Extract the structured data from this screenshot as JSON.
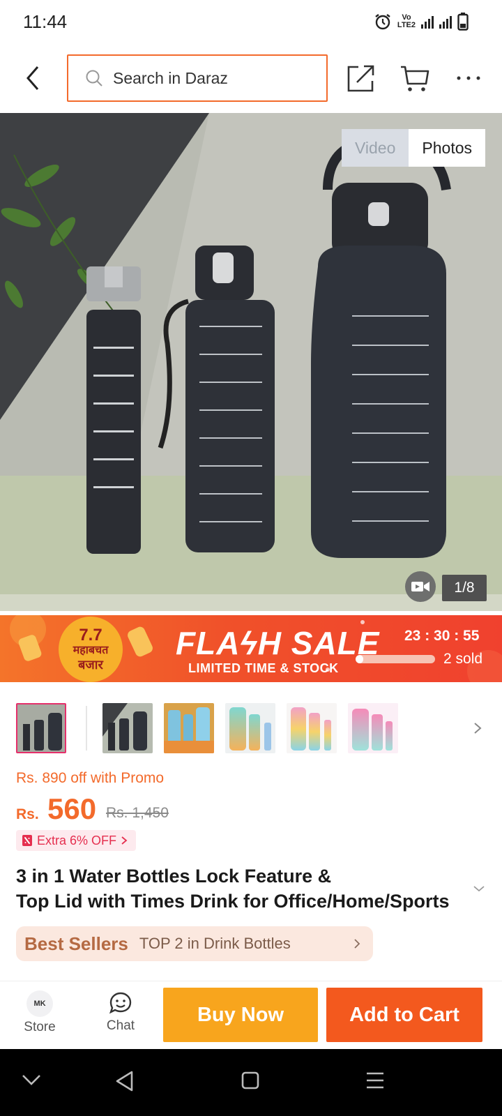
{
  "status_bar": {
    "time": "11:44",
    "network_label_1": "Vo",
    "network_label_2": "LTE2"
  },
  "header": {
    "search_placeholder": "Search in Daraz"
  },
  "media": {
    "toggle_video": "Video",
    "toggle_photos": "Photos",
    "counter": "1/8"
  },
  "flash_sale": {
    "title": "FLAϟH SALE",
    "subtitle": "LIMITED TIME & STOCK",
    "timer": "23 : 30 : 55",
    "sold": "2 sold",
    "sold_progress": 0.1,
    "badge_line1": "7.7",
    "badge_line2": "महाबचत",
    "badge_line3": "बजार"
  },
  "price": {
    "promo": "Rs. 890 off with Promo",
    "currency": "Rs.",
    "current": "560",
    "original": "Rs. 1,450",
    "extra_off": "Extra 6% OFF"
  },
  "product": {
    "title_line1": "3 in 1 Water Bottles Lock Feature &",
    "title_line2": "Top Lid with Times Drink for Office/Home/Sports"
  },
  "best_seller": {
    "label": "Best Sellers",
    "rank": "TOP 2 in Drink Bottles"
  },
  "bottom_bar": {
    "store": "Store",
    "chat": "Chat",
    "buy_now": "Buy Now",
    "add_to_cart": "Add to Cart",
    "store_logo": "MK"
  },
  "colors": {
    "accent": "#f36a2b",
    "buy_now": "#f8a51d",
    "add_to_cart": "#f3591e",
    "promo_pink": "#e52f4f"
  }
}
